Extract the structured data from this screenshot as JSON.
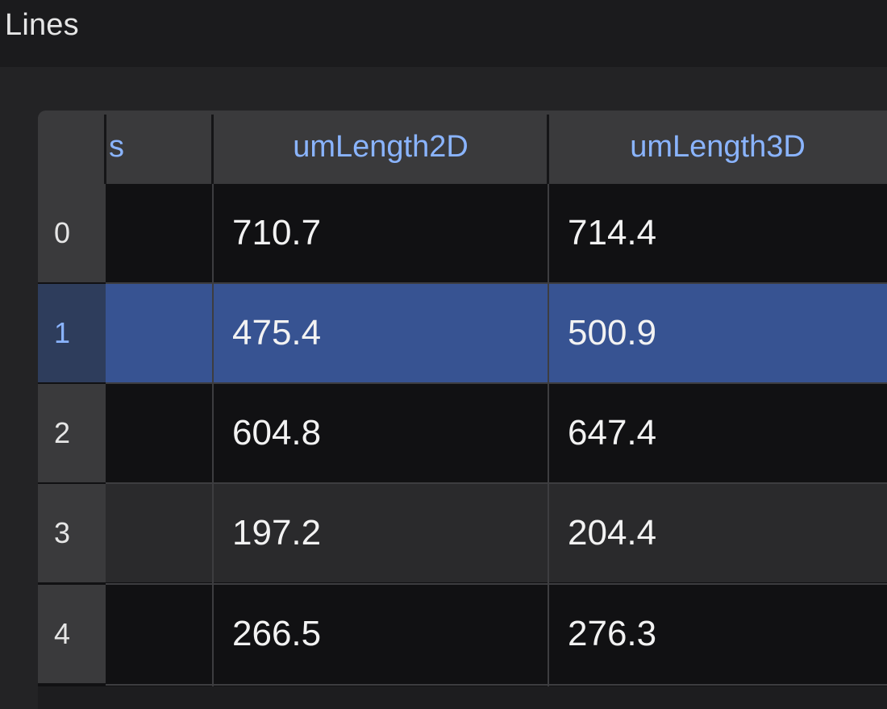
{
  "window": {
    "title": "Lines"
  },
  "table": {
    "columns": [
      {
        "label": "s"
      },
      {
        "label": "umLength2D"
      },
      {
        "label": "umLength3D"
      }
    ],
    "rows": [
      {
        "index": "0",
        "a": "",
        "b": "710.7",
        "c": "714.4"
      },
      {
        "index": "1",
        "a": "",
        "b": "475.4",
        "c": "500.9"
      },
      {
        "index": "2",
        "a": "",
        "b": "604.8",
        "c": "647.4"
      },
      {
        "index": "3",
        "a": "",
        "b": "197.2",
        "c": "204.4"
      },
      {
        "index": "4",
        "a": "",
        "b": "266.5",
        "c": "276.3"
      }
    ],
    "selected_row": "1"
  },
  "colors": {
    "header_text": "#8ab4ff",
    "selection": "#375392",
    "background": "#111113"
  }
}
